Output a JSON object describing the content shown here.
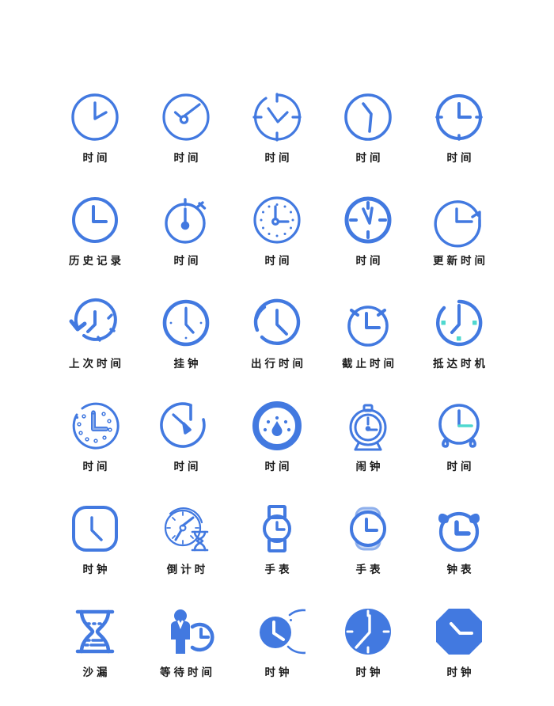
{
  "palette": {
    "background": "#ffffff",
    "primary": "#4279e0",
    "primary_light": "#8fb0ec",
    "accent_teal": "#4fd8cf",
    "label_color": "#1b1b1b"
  },
  "grid": {
    "columns": 5,
    "rows": 6
  },
  "icons": [
    {
      "name": "clock-plain-4oclock",
      "label": "时间"
    },
    {
      "name": "clock-center-hub-hands",
      "label": "时间"
    },
    {
      "name": "clock-tick-marks-open",
      "label": "时间"
    },
    {
      "name": "clock-bent-hand",
      "label": "时间"
    },
    {
      "name": "clock-bold-tick-marks",
      "label": "时间"
    },
    {
      "name": "clock-history-record",
      "label": "历史记录"
    },
    {
      "name": "stopwatch-timer",
      "label": "时间"
    },
    {
      "name": "clock-dotted-dial",
      "label": "时间"
    },
    {
      "name": "clock-thick-ring-ticks",
      "label": "时间"
    },
    {
      "name": "clock-refresh-arrow",
      "label": "更新时间"
    },
    {
      "name": "clock-back-arrow-last-time",
      "label": "上次时间"
    },
    {
      "name": "wall-clock",
      "label": "挂钟"
    },
    {
      "name": "clock-departure-time",
      "label": "出行时间"
    },
    {
      "name": "alarm-clock-deadline",
      "label": "截止时间"
    },
    {
      "name": "clock-arrival-teal-marks",
      "label": "抵达时机"
    },
    {
      "name": "clock-circle-dots-dial",
      "label": "时间"
    },
    {
      "name": "clock-single-pointer-gauge",
      "label": "时间"
    },
    {
      "name": "clock-filled-gauge",
      "label": "时间"
    },
    {
      "name": "alarm-clock-bell-top",
      "label": "闹钟"
    },
    {
      "name": "desk-clock-teal-hand",
      "label": "时间"
    },
    {
      "name": "clock-rounded-square",
      "label": "时钟"
    },
    {
      "name": "countdown-clock-hourglass",
      "label": "倒计时"
    },
    {
      "name": "wristwatch-square-band",
      "label": "手表"
    },
    {
      "name": "wristwatch-rounded-band",
      "label": "手表"
    },
    {
      "name": "alarm-clock-twin-bells",
      "label": "钟表"
    },
    {
      "name": "hourglass-sand",
      "label": "沙漏"
    },
    {
      "name": "person-waiting-time",
      "label": "等待时间"
    },
    {
      "name": "clock-filled-with-ring",
      "label": "时钟"
    },
    {
      "name": "clock-filled-tick-marks",
      "label": "时钟"
    },
    {
      "name": "clock-octagon-filled",
      "label": "时钟"
    }
  ]
}
